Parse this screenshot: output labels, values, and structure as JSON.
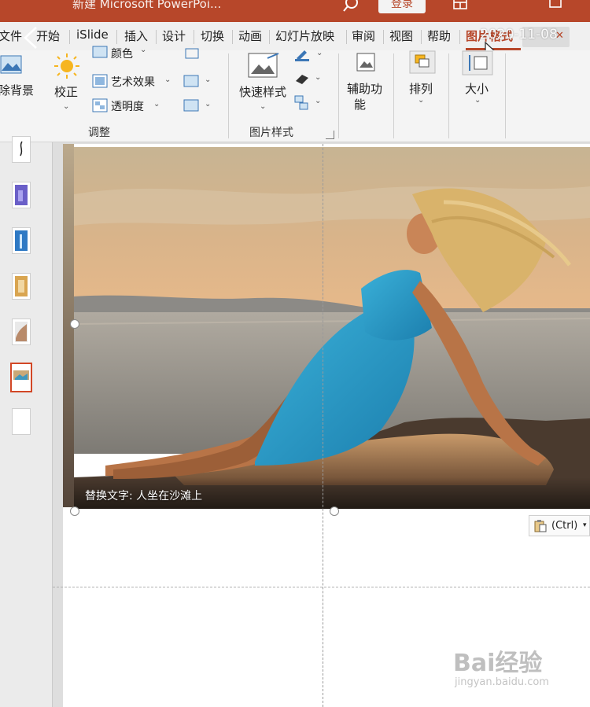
{
  "window": {
    "title": "新建 Microsoft PowerPoi...",
    "login_label": "登录"
  },
  "tabs": [
    {
      "label": "文件"
    },
    {
      "label": "开始"
    },
    {
      "label": "iSlide"
    },
    {
      "label": "插入"
    },
    {
      "label": "设计"
    },
    {
      "label": "切换"
    },
    {
      "label": "动画"
    },
    {
      "label": "幻灯片放映"
    },
    {
      "label": "审阅"
    },
    {
      "label": "视图"
    },
    {
      "label": "帮助"
    },
    {
      "label": "图片格式",
      "active": true
    }
  ],
  "video_date": "2020-11-08",
  "ribbon": {
    "remove_bg": "除背景",
    "correct": "校正",
    "color": "颜色",
    "artistic": "艺术效果",
    "transparency": "透明度",
    "group_adjust": "调整",
    "quick_styles": "快速样式",
    "group_picture_styles": "图片样式",
    "accessibility_line1": "辅助功",
    "accessibility_line2": "能",
    "arrange": "排列",
    "size": "大小"
  },
  "slide": {
    "alt_text_caption": "替换文字: 人坐在沙滩上",
    "paste_options_label": "(Ctrl)"
  },
  "watermark": {
    "brand": "Bai经验",
    "url": "jingyan.baidu.com"
  },
  "colors": {
    "accent": "#b7472a",
    "selection_border": "#d24726"
  },
  "icons": [
    "search-icon",
    "ribbon-display-icon",
    "minimize-icon",
    "back-arrow-icon",
    "mouse-cursor-icon",
    "sun-icon",
    "paste-clipboard-icon"
  ]
}
